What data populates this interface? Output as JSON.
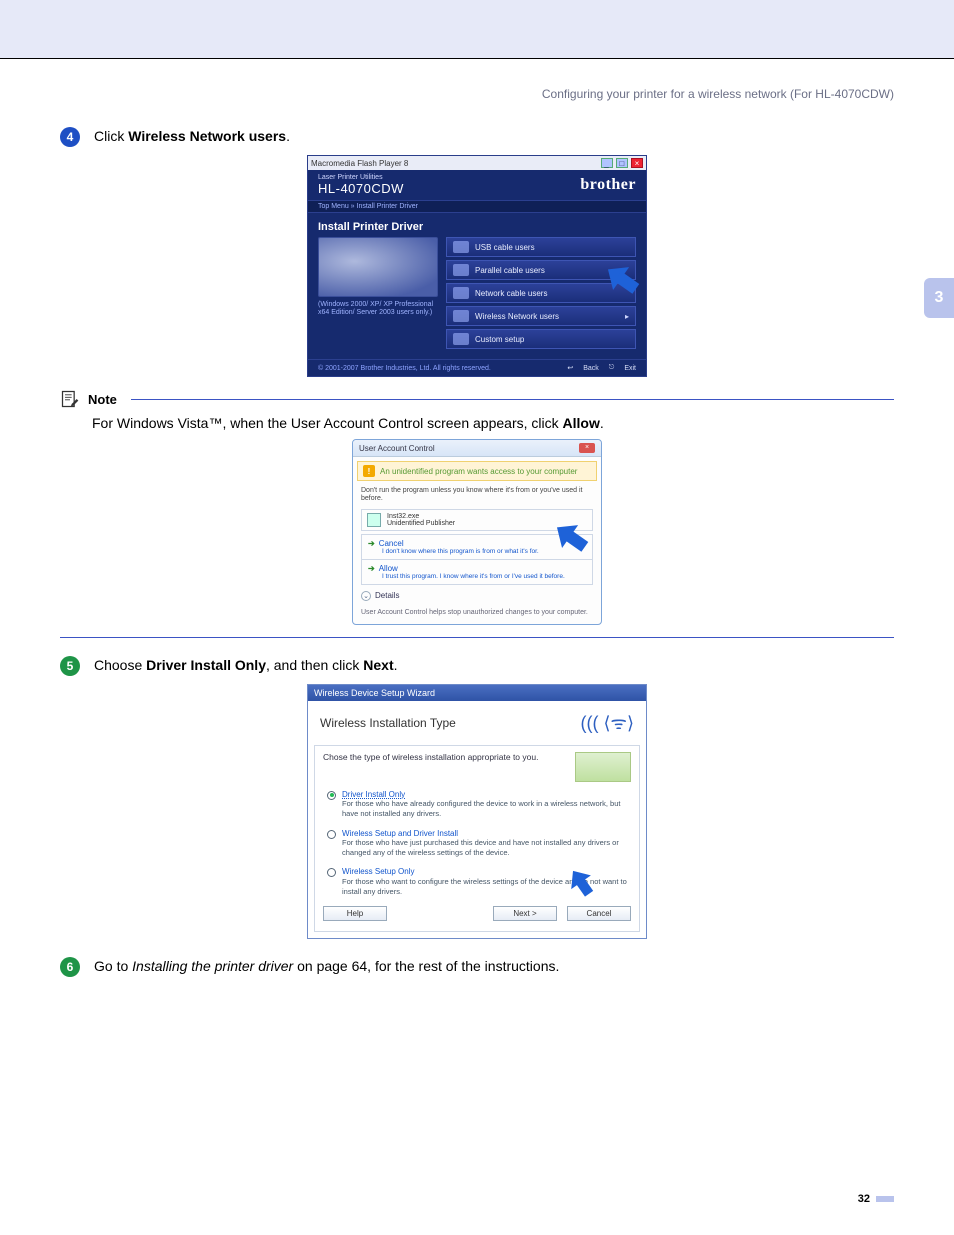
{
  "header": {
    "running_head": "Configuring your printer for a wireless network (For HL-4070CDW)"
  },
  "chapter_tab": "3",
  "page_number": "32",
  "steps": {
    "s4": {
      "num": "4",
      "pre": "Click ",
      "bold": "Wireless Network users",
      "post": "."
    },
    "s5": {
      "num": "5",
      "pre": "Choose ",
      "bold1": "Driver Install Only",
      "mid": ", and then click ",
      "bold2": "Next",
      "post": "."
    },
    "s6": {
      "num": "6",
      "pre": "Go to ",
      "italic": "Installing the printer driver",
      "post": " on page 64, for the rest of the instructions."
    }
  },
  "note": {
    "label": "Note",
    "body_pre": "For Windows Vista™, when the User Account Control screen appears, click ",
    "body_bold": "Allow",
    "body_post": "."
  },
  "fig1": {
    "window_title": "Macromedia Flash Player 8",
    "product_sub": "Laser Printer Utilities",
    "product_model": "HL-4070CDW",
    "brand": "brother",
    "breadcrumb": "Top Menu  »  Install Printer Driver",
    "section_title": "Install Printer Driver",
    "left_desc": "(Windows 2000/ XP/ XP Professional x64 Edition/ Server 2003 users only.)",
    "options": {
      "o1": "USB cable users",
      "o2": "Parallel cable users",
      "o3": "Network cable users",
      "o4": "Wireless Network users",
      "o5": "Custom setup"
    },
    "copyright": "© 2001-2007 Brother Industries, Ltd. All rights reserved.",
    "back": "Back",
    "exit": "Exit"
  },
  "uac": {
    "title": "User Account Control",
    "banner": "An unidentified program wants access to your computer",
    "para": "Don't run the program unless you know where it's from or you've used it before.",
    "prog_name": "Inst32.exe",
    "prog_pub": "Unidentified Publisher",
    "cancel_title": "Cancel",
    "cancel_desc": "I don't know where this program is from or what it's for.",
    "allow_title": "Allow",
    "allow_desc": "I trust this program. I know where it's from or I've used it before.",
    "details": "Details",
    "footer": "User Account Control helps stop unauthorized changes to your computer."
  },
  "wiz": {
    "titlebar": "Wireless Device Setup Wizard",
    "heading": "Wireless Installation Type",
    "lead": "Chose the type of wireless installation appropriate to you.",
    "r1_title": "Driver Install Only",
    "r1_desc": "For those who have already configured the device to work in a wireless network, but have not installed any drivers.",
    "r2_title": "Wireless Setup and Driver Install",
    "r2_desc": "For those who have just purchased this device and have not installed any drivers or changed any of the wireless settings of the device.",
    "r3_title": "Wireless Setup Only",
    "r3_desc": "For those who want to configure the wireless settings of the device and do not want to install any drivers.",
    "help": "Help",
    "next": "Next >",
    "cancel": "Cancel"
  }
}
